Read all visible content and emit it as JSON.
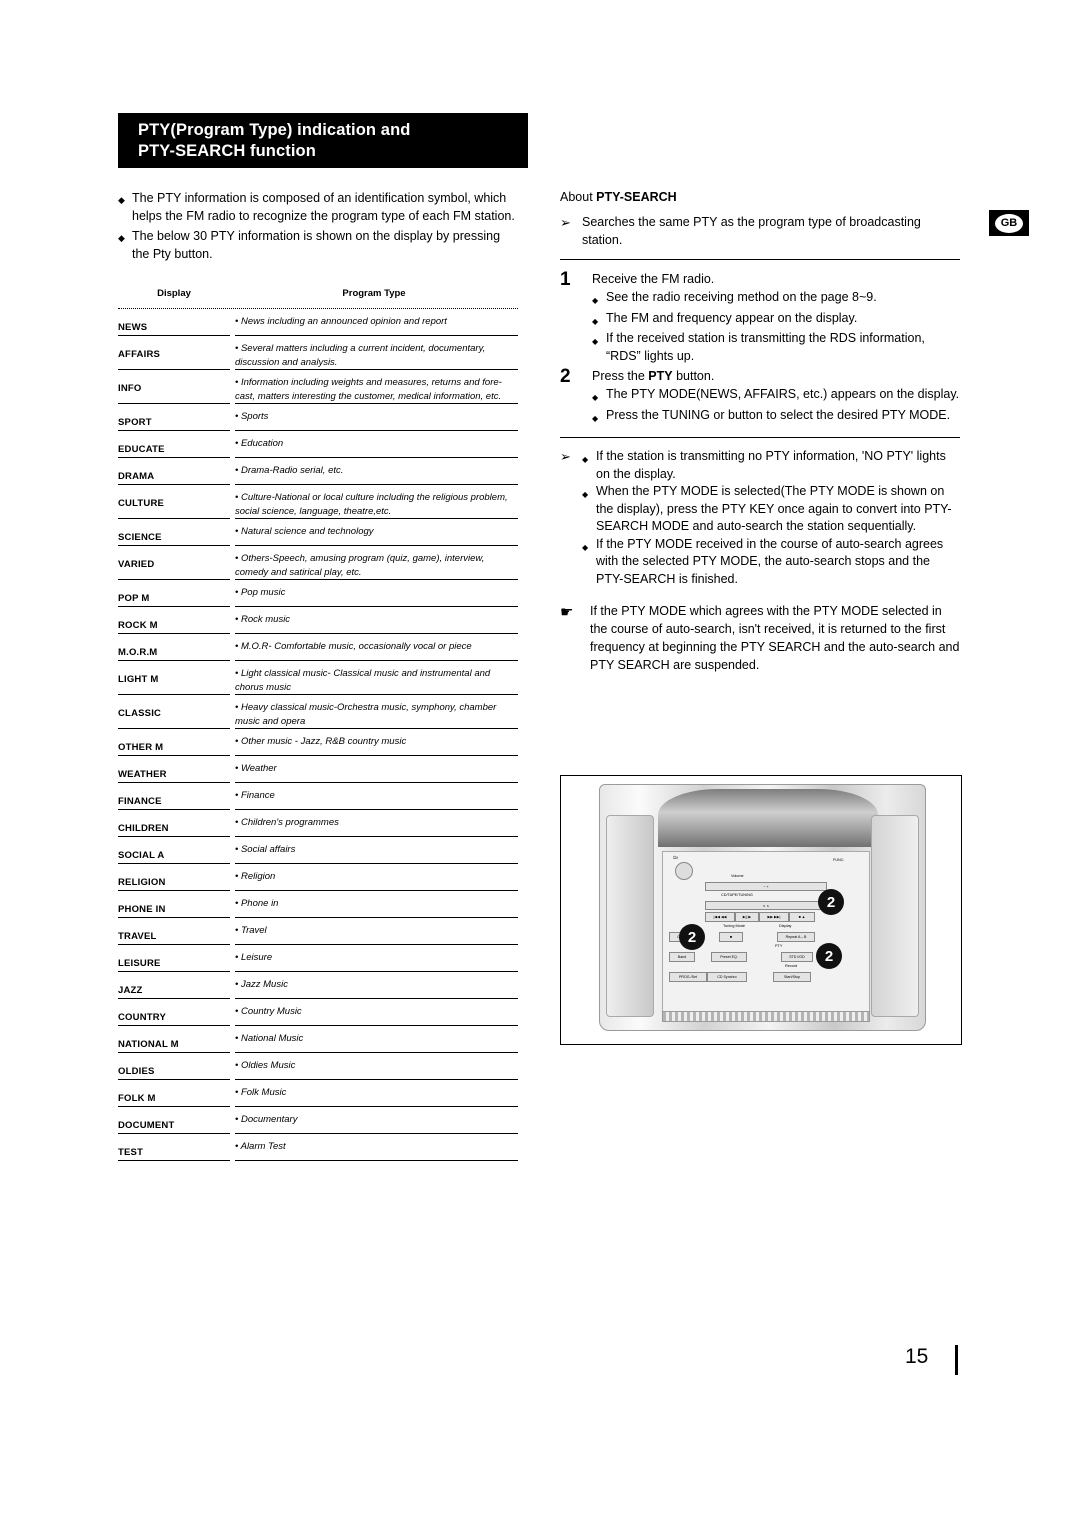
{
  "header": {
    "title_line1": "PTY(Program Type) indication and",
    "title_line2": "PTY-SEARCH function"
  },
  "badge": {
    "region": "GB"
  },
  "left": {
    "intro": [
      "The PTY information is composed of an identification symbol, which helps the FM radio to recognize the program type of each FM station.",
      "The below 30 PTY information is shown on the display by pressing the Pty button."
    ],
    "table": {
      "headers": [
        "Display",
        "Program Type"
      ],
      "rows": [
        {
          "display": "NEWS",
          "type": "• News including an announced opinion and report"
        },
        {
          "display": "AFFAIRS",
          "type": "• Several matters including a current incident, documentary, discussion and analysis."
        },
        {
          "display": "INFO",
          "type": "• Information including weights and measures, returns and fore-cast, matters interesting the customer, medical information, etc."
        },
        {
          "display": "SPORT",
          "type": "• Sports"
        },
        {
          "display": "EDUCATE",
          "type": "• Education"
        },
        {
          "display": "DRAMA",
          "type": "• Drama-Radio serial, etc."
        },
        {
          "display": "CULTURE",
          "type": "• Culture-National or local culture including the religious problem, social science, language, theatre,etc."
        },
        {
          "display": "SCIENCE",
          "type": "• Natural science and technology"
        },
        {
          "display": "VARIED",
          "type": "• Others-Speech, amusing program (quiz, game), interview, comedy and satirical play, etc."
        },
        {
          "display": "POP M",
          "type": "• Pop music"
        },
        {
          "display": "ROCK M",
          "type": "• Rock music"
        },
        {
          "display": "M.O.R.M",
          "type": "• M.O.R- Comfortable music, occasionally vocal or piece"
        },
        {
          "display": "LIGHT M",
          "type": "• Light classical music- Classical music and instrumental and chorus music"
        },
        {
          "display": "CLASSIC",
          "type": "• Heavy classical  music-Orchestra music, symphony, chamber music and opera"
        },
        {
          "display": "OTHER M",
          "type": "• Other music - Jazz, R&B country music"
        },
        {
          "display": "WEATHER",
          "type": "• Weather"
        },
        {
          "display": "FINANCE",
          "type": "• Finance"
        },
        {
          "display": "CHILDREN",
          "type": "• Children's programmes"
        },
        {
          "display": "SOCIAL  A",
          "type": "• Social affairs"
        },
        {
          "display": "RELIGION",
          "type": "• Religion"
        },
        {
          "display": "PHONE IN",
          "type": "• Phone in"
        },
        {
          "display": "TRAVEL",
          "type": "• Travel"
        },
        {
          "display": "LEISURE",
          "type": "• Leisure"
        },
        {
          "display": "JAZZ",
          "type": "• Jazz Music"
        },
        {
          "display": "COUNTRY",
          "type": "• Country Music"
        },
        {
          "display": "NATIONAL M",
          "type": "• National Music"
        },
        {
          "display": "OLDIES",
          "type": "• Oldies Music"
        },
        {
          "display": "FOLK M",
          "type": "• Folk Music"
        },
        {
          "display": "DOCUMENT",
          "type": "• Documentary"
        },
        {
          "display": "TEST",
          "type": "• Alarm Test"
        }
      ]
    }
  },
  "right": {
    "section_title_light": "About ",
    "section_title_bold": "PTY-SEARCH",
    "lead": "Searches the same PTY as the program type of broadcasting station.",
    "steps": [
      {
        "num": "1",
        "head": "Receive the FM radio.",
        "items": [
          "See the radio receiving method on the page 8~9.",
          "The FM and frequency appear on the display.",
          "If the received station is transmitting the RDS information, “RDS” lights up."
        ]
      },
      {
        "num": "2",
        "head_pre": "Press the ",
        "head_bold": "PTY",
        "head_post": " button.",
        "items": [
          "The PTY MODE(NEWS, AFFAIRS, etc.) appears on the display.",
          "Press the TUNING        or        button to select the desired PTY MODE."
        ]
      }
    ],
    "notes": [
      "If the station is transmitting no PTY information, 'NO PTY' lights on the display.",
      "When the PTY MODE is selected(The PTY MODE is shown on the display), press the PTY KEY once again to convert into PTY-SEARCH MODE and auto-search the station sequentially.",
      "If the PTY MODE received in the course of auto-search agrees with the selected PTY MODE, the auto-search stops and the PTY-SEARCH is finished."
    ],
    "tip": "If the PTY MODE which agrees with the PTY MODE selected in the course of auto-search, isn't received, it is returned to the first frequency at beginning the PTY SEARCH and the auto-search and PTY SEARCH are suspended.",
    "figure": {
      "callouts": [
        "2",
        "2",
        "2"
      ],
      "labels": [
        "FUNC.",
        "Volume",
        "CD/TAPE/TUNING",
        "Tuning Mode",
        "Display",
        "CD Repeat",
        "Repeat A↔B",
        "PTY",
        "Band",
        "Preset EQ.",
        "STD I/OD",
        "Record",
        "PROG./Set",
        "CD Synchro",
        "Start/Stop"
      ]
    }
  },
  "footer": {
    "page_number": "15"
  }
}
